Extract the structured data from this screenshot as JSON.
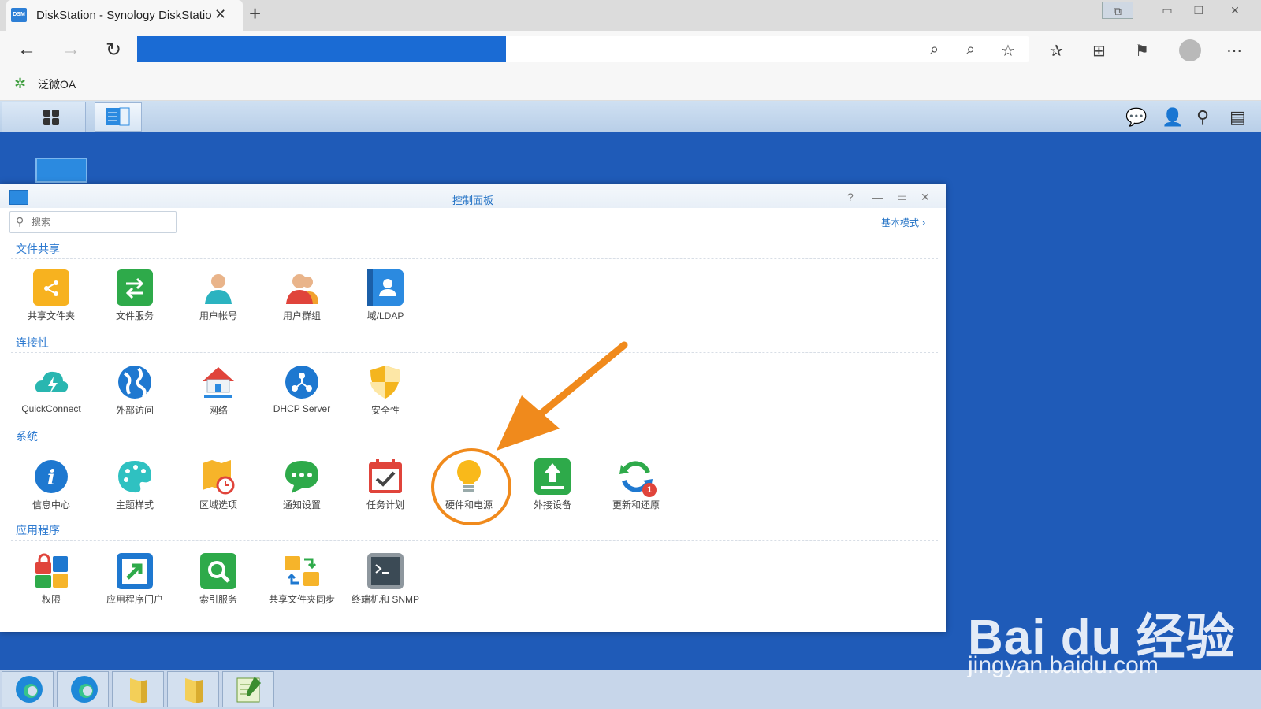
{
  "browser": {
    "tab_title": "DiskStation - Synology DiskStation",
    "favicon_text": "DSM",
    "close_glyph": "✕",
    "newtab_glyph": "+",
    "bookmark_label": "泛微OA"
  },
  "dsm": {
    "window_title": "控制面板",
    "search_placeholder": "搜索",
    "basic_mode": "基本模式",
    "sections": {
      "file_sharing": "文件共享",
      "connectivity": "连接性",
      "system": "系统",
      "applications": "应用程序"
    },
    "apps": {
      "shared_folder": "共享文件夹",
      "file_services": "文件服务",
      "user_account": "用户帐号",
      "user_group": "用户群组",
      "domain_ldap": "域/LDAP",
      "quickconnect": "QuickConnect",
      "external_access": "外部访问",
      "network": "网络",
      "dhcp_server": "DHCP Server",
      "security": "安全性",
      "info_center": "信息中心",
      "theme": "主题样式",
      "regional": "区域选项",
      "notification": "通知设置",
      "task_scheduler": "任务计划",
      "hardware_power": "硬件和电源",
      "external_devices": "外接设备",
      "update_restore": "更新和还原",
      "privileges": "权限",
      "app_portal": "应用程序门户",
      "indexing": "索引服务",
      "folder_sync": "共享文件夹同步",
      "terminal_snmp": "终端机和 SNMP"
    },
    "update_badge": "1"
  },
  "watermark": {
    "brand": "Bai du 经验",
    "url": "jingyan.baidu.com"
  },
  "colors": {
    "accent": "#1e6fc4",
    "highlight": "#f08a1c",
    "desktop": "#1f5bb8"
  }
}
